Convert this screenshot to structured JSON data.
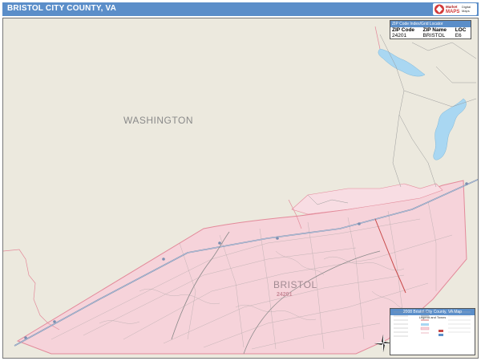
{
  "title": "BRISTOL CITY COUNTY, VA",
  "brand": {
    "text_top": "Market",
    "text_mid": "MAPS",
    "text_bottom": "Digital Maps"
  },
  "labels": {
    "washington": "WASHINGTON",
    "bristol": "BRISTOL",
    "bristol_zip": "24201"
  },
  "zip_index": {
    "heading": "ZIP Code Index/Grid Locator",
    "columns": [
      "ZIP Code",
      "ZIP Name",
      "LOC"
    ],
    "rows": [
      [
        "24201",
        "BRISTOL",
        "E6"
      ]
    ]
  },
  "legend": {
    "heading": "2008 Bristol City County, VA Map",
    "subheading": "Legend and Towns"
  },
  "colors": {
    "land": "#ece9de",
    "city": "#f6d3da",
    "water": "#a9d7f2",
    "road": "#8a8a8a",
    "highway": "#7a8fb0",
    "rail": "#c84848",
    "boundary": "#e38a9a",
    "title_bar": "#5b8ec9"
  }
}
